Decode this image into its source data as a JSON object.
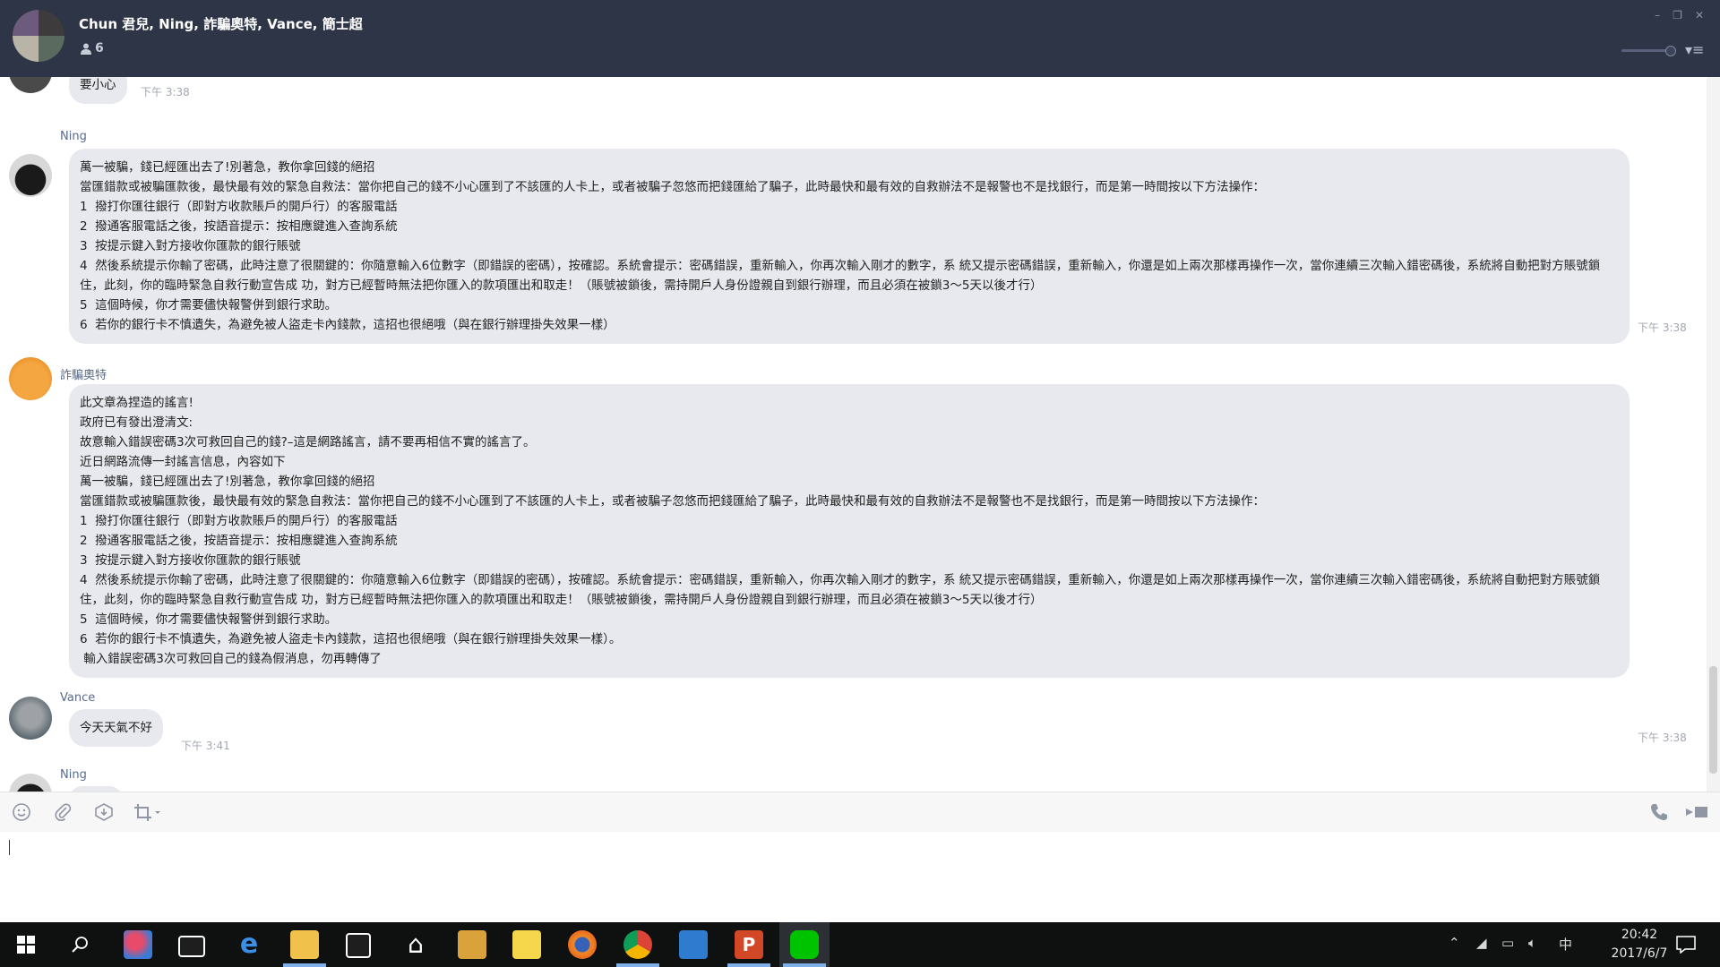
{
  "header": {
    "title": "Chun 君兒, Ning, 詐騙奧特, Vance, 簡士超",
    "member_count": "6"
  },
  "chat": {
    "prev_tail": {
      "text": "要小心",
      "time": "下午 3:38"
    },
    "messages": [
      {
        "sender": "Ning",
        "time": "下午 3:38",
        "lines": [
          "萬一被騙，錢已經匯出去了!別著急，教你拿回錢的絕招",
          "當匯錯款或被騙匯款後，最快最有效的緊急自救法：當你把自己的錢不小心匯到了不該匯的人卡上，或者被騙子忽悠而把錢匯給了騙子，此時最快和最有效的自救辦法不是報警也不是找銀行，而是第一時間按以下方法操作：",
          "1  撥打你匯往銀行（即對方收款賬戶的開戶行）的客服電話",
          "2  撥通客服電話之後，按語音提示：按相應鍵進入查詢系統",
          "3  按提示鍵入對方接收你匯款的銀行賬號",
          "4  然後系統提示你輸了密碼，此時注意了很關鍵的：你隨意輸入6位數字（即錯誤的密碼），按確認。系統會提示：密碼錯誤，重新輸入，你再次輸入剛才的數字，系 統又提示密碼錯誤，重新輸入，你還是如上兩次那樣再操作一次，當你連續三次輸入錯密碼後，系統將自動把對方賬號鎖住，此刻，你的臨時緊急自救行動宣告成 功，對方已經暫時無法把你匯入的款項匯出和取走！（賬號被鎖後，需持開戶人身份證親自到銀行辦理，而且必須在被鎖3～5天以後才行）",
          "5  這個時候，你才需要儘快報警併到銀行求助。",
          "6  若你的銀行卡不慎遺失，為避免被人盜走卡內錢款，這招也很絕哦（與在銀行辦理掛失效果一樣）"
        ]
      },
      {
        "sender": "詐騙奧特",
        "time": "下午 3:38",
        "lines": [
          "此文章為捏造的謠言!",
          "政府已有發出澄清文:",
          "故意輸入錯誤密碼3次可救回自己的錢?–這是網路謠言，請不要再相信不實的謠言了。",
          "近日網路流傳一封謠言信息，內容如下",
          "萬一被騙，錢已經匯出去了!別著急，教你拿回錢的絕招",
          "當匯錯款或被騙匯款後，最快最有效的緊急自救法：當你把自己的錢不小心匯到了不該匯的人卡上，或者被騙子忽悠而把錢匯給了騙子，此時最快和最有效的自救辦法不是報警也不是找銀行，而是第一時間按以下方法操作：",
          "1  撥打你匯往銀行（即對方收款賬戶的開戶行）的客服電話",
          "2  撥通客服電話之後，按語音提示：按相應鍵進入查詢系統",
          "3  按提示鍵入對方接收你匯款的銀行賬號",
          "4  然後系統提示你輸了密碼，此時注意了很關鍵的：你隨意輸入6位數字（即錯誤的密碼），按確認。系統會提示：密碼錯誤，重新輸入，你再次輸入剛才的數字，系 統又提示密碼錯誤，重新輸入，你還是如上兩次那樣再操作一次，當你連續三次輸入錯密碼後，系統將自動把對方賬號鎖住，此刻，你的臨時緊急自救行動宣告成 功，對方已經暫時無法把你匯入的款項匯出和取走！（賬號被鎖後，需持開戶人身份證親自到銀行辦理，而且必須在被鎖3～5天以後才行）",
          "5  這個時候，你才需要儘快報警併到銀行求助。",
          "6  若你的銀行卡不慎遺失，為避免被人盜走卡內錢款，這招也很絕哦（與在銀行辦理掛失效果一樣）。",
          " 輸入錯誤密碼3次可救回自己的錢為假消息，勿再轉傳了"
        ]
      },
      {
        "sender": "Vance",
        "time": "下午 3:41",
        "lines": [
          "今天天氣不好"
        ]
      },
      {
        "sender": "Ning",
        "time": "",
        "lines": []
      }
    ]
  },
  "taskbar": {
    "time": "20:42",
    "date": "2017/6/7",
    "ime": "中"
  },
  "colors": {
    "header_bg": "#2d3547",
    "bubble_bg": "#e7e9ee",
    "line_green": "#00c300"
  }
}
